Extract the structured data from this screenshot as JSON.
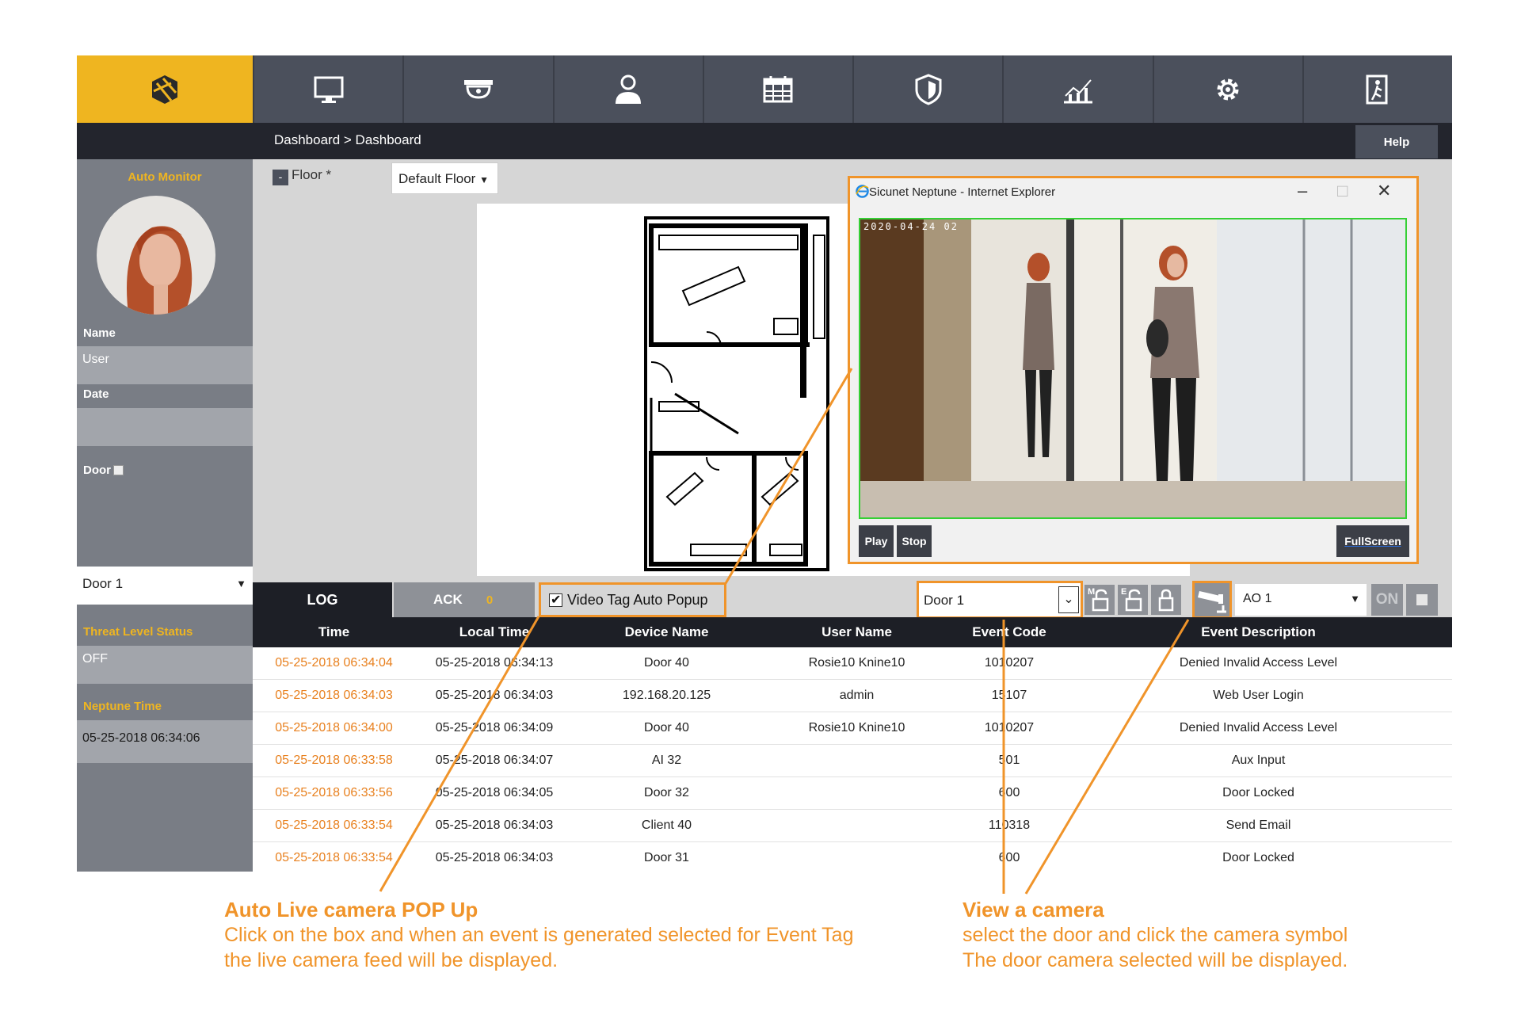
{
  "breadcrumb": "Dashboard > Dashboard",
  "help_label": "Help",
  "sidebar": {
    "auto_monitor": "Auto Monitor",
    "name_label": "Name",
    "name_value": "User",
    "date_label": "Date",
    "date_value": "",
    "door_label": "Door",
    "door_select": "Door 1",
    "threat_label": "Threat Level Status",
    "threat_value": "OFF",
    "time_label": "Neptune Time",
    "time_value": "05-25-2018 06:34:06"
  },
  "floor": {
    "label": "Floor *",
    "minus": "-",
    "select_value": "Default Floor"
  },
  "popup": {
    "title": "Sicunet Neptune - Internet Explorer",
    "timestamp": "2020-04-24 02",
    "play": "Play",
    "stop": "Stop",
    "fullscreen": "FullScreen"
  },
  "toolbar": {
    "log": "LOG",
    "ack": "ACK",
    "ack_count": "0",
    "video_tag": "Video Tag Auto Popup",
    "door_select": "Door 1",
    "ao_select": "AO 1",
    "on": "ON"
  },
  "table": {
    "headers": [
      "Time",
      "Local Time",
      "Device Name",
      "User Name",
      "Event Code",
      "Event Description"
    ],
    "rows": [
      [
        "05-25-2018 06:34:04",
        "05-25-2018 06:34:13",
        "Door 40",
        "Rosie10 Knine10",
        "1010207",
        "Denied Invalid Access Level"
      ],
      [
        "05-25-2018 06:34:03",
        "05-25-2018 06:34:03",
        "192.168.20.125",
        "admin",
        "15107",
        "Web User Login"
      ],
      [
        "05-25-2018 06:34:00",
        "05-25-2018 06:34:09",
        "Door 40",
        "Rosie10 Knine10",
        "1010207",
        "Denied Invalid Access Level"
      ],
      [
        "05-25-2018 06:33:58",
        "05-25-2018 06:34:07",
        "AI 32",
        "",
        "501",
        "Aux Input"
      ],
      [
        "05-25-2018 06:33:56",
        "05-25-2018 06:34:05",
        "Door 32",
        "",
        "600",
        "Door Locked"
      ],
      [
        "05-25-2018 06:33:54",
        "05-25-2018 06:34:03",
        "Client 40",
        "",
        "110318",
        "Send Email"
      ],
      [
        "05-25-2018 06:33:54",
        "05-25-2018 06:34:03",
        "Door 31",
        "",
        "600",
        "Door Locked"
      ]
    ]
  },
  "annotations": {
    "left_title": "Auto Live camera POP Up",
    "left_line1": "Click on the box and when an event is generated selected for Event Tag",
    "left_line2": "the live camera feed will be displayed.",
    "right_title": "View a camera",
    "right_line1": "select the door and click the camera symbol",
    "right_line2": "The door camera selected will be displayed."
  },
  "icons": {
    "nav": [
      "cube-logo-icon",
      "monitor-icon",
      "camera-dome-icon",
      "user-icon",
      "calendar-icon",
      "shield-icon",
      "chart-icon",
      "gear-icon",
      "exit-door-icon"
    ]
  },
  "colors": {
    "accent": "#efb520",
    "annotation": "#f0942a",
    "nav_bg": "#4b505c",
    "time_text": "#e8801e"
  }
}
